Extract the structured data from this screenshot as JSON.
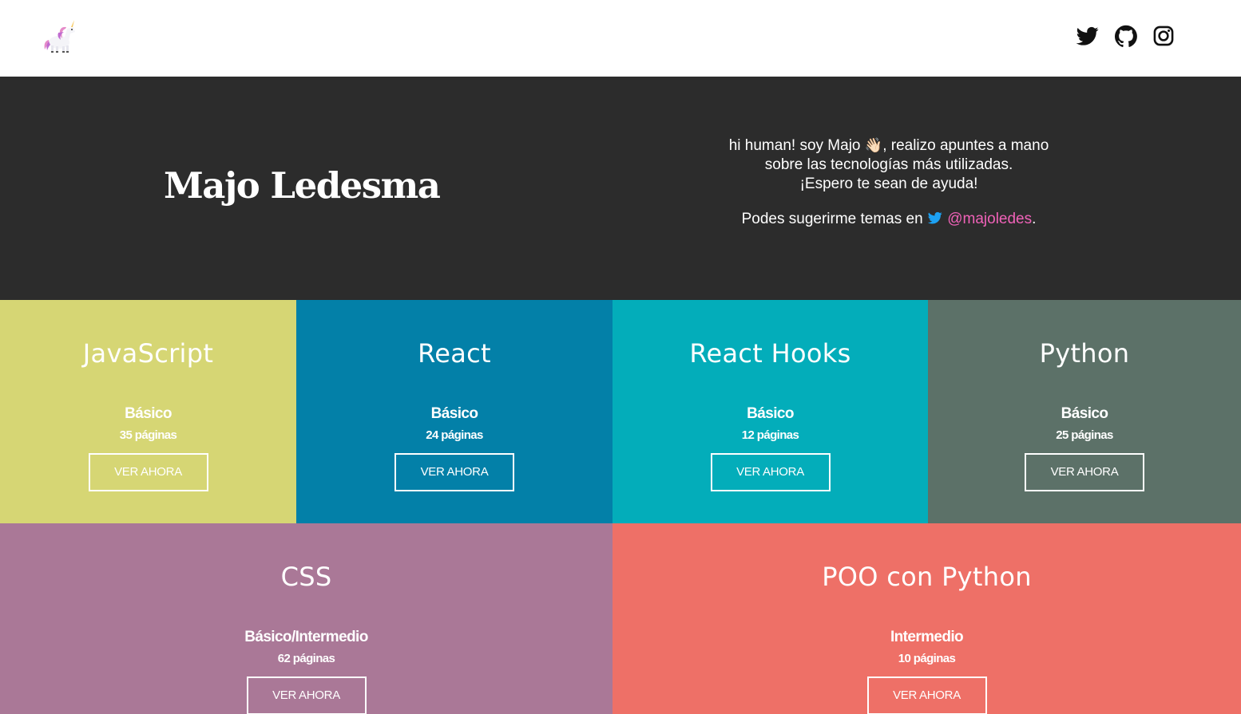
{
  "header": {
    "logo_icon": "unicorn-icon",
    "social": [
      {
        "name": "twitter",
        "icon": "twitter-icon"
      },
      {
        "name": "github",
        "icon": "github-icon"
      },
      {
        "name": "instagram",
        "icon": "instagram-icon"
      }
    ]
  },
  "hero": {
    "title": "Majo Ledesma",
    "intro_before_emoji": "hi human! soy Majo",
    "emoji": "👋🏻",
    "intro_after_emoji": ", realizo apuntes a mano",
    "intro_line2": "sobre las tecnologías más utilizadas.",
    "intro_line3": "¡Espero te sean de ayuda!",
    "suggest_text": "Podes sugerirme temas en",
    "twitter_handle": "@majoledes",
    "suggest_end": ".",
    "handle_color": "#f062b8"
  },
  "cards": [
    {
      "title": "JavaScript",
      "level": "Básico",
      "pages": "35 páginas",
      "button": "VER AHORA",
      "color": "#d6d674"
    },
    {
      "title": "React",
      "level": "Básico",
      "pages": "24 páginas",
      "button": "VER AHORA",
      "color": "#0380a8"
    },
    {
      "title": "React Hooks",
      "level": "Básico",
      "pages": "12 páginas",
      "button": "VER AHORA",
      "color": "#03adba"
    },
    {
      "title": "Python",
      "level": "Básico",
      "pages": "25 páginas",
      "button": "VER AHORA",
      "color": "#5c7168"
    },
    {
      "title": "CSS",
      "level": "Básico/Intermedio",
      "pages": "62 páginas",
      "button": "VER AHORA",
      "color": "#aa7897"
    },
    {
      "title": "POO con Python",
      "level": "Intermedio",
      "pages": "10 páginas",
      "button": "VER AHORA",
      "color": "#ee7067"
    }
  ]
}
